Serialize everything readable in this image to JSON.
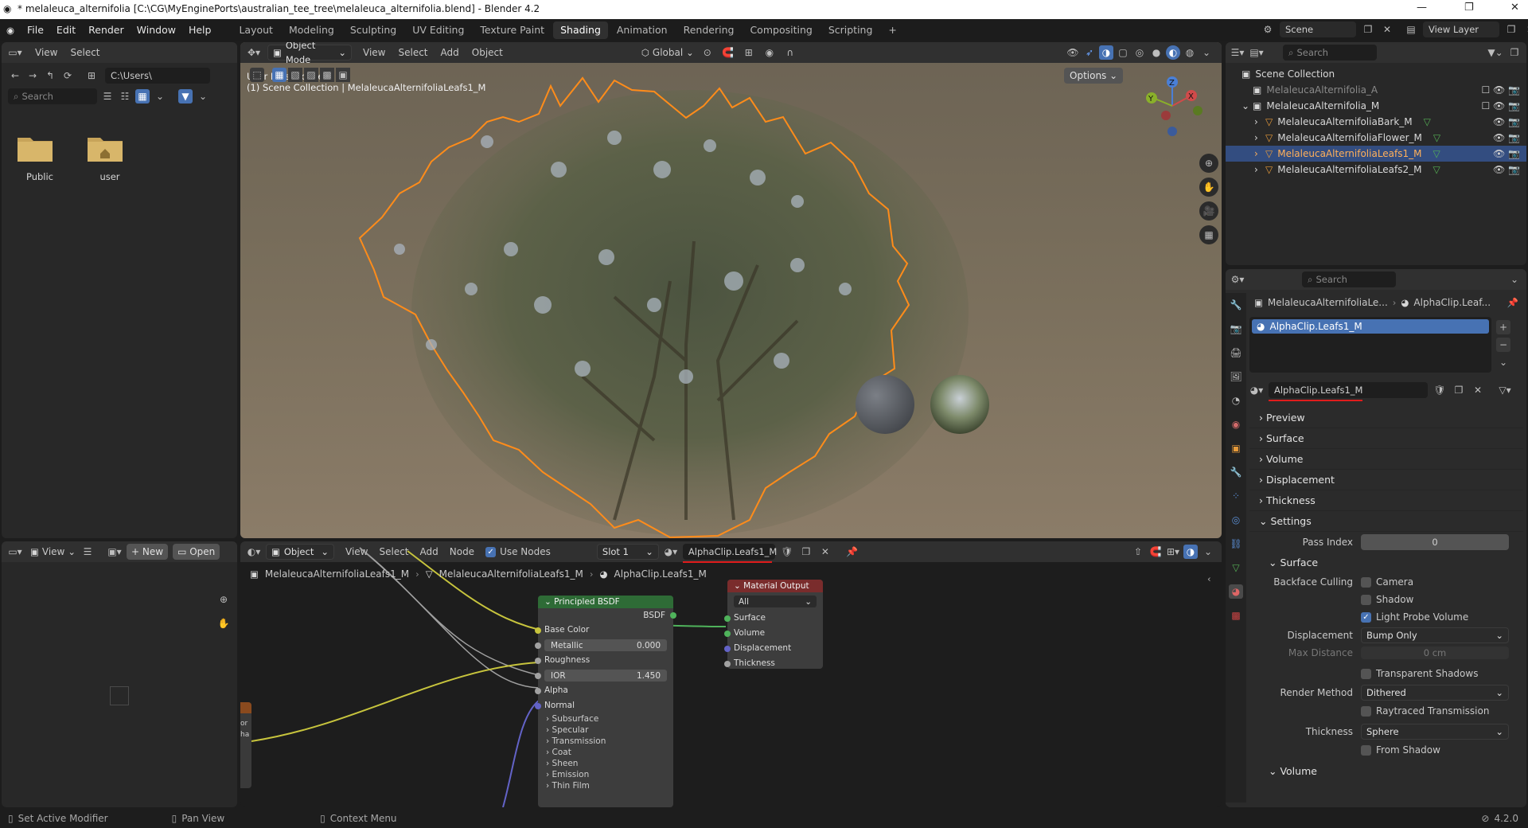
{
  "window": {
    "title": "* melaleuca_alternifolia [C:\\CG\\MyEnginePorts\\australian_tee_tree\\melaleuca_alternifolia.blend] - Blender 4.2"
  },
  "menubar": {
    "menus": [
      "File",
      "Edit",
      "Render",
      "Window",
      "Help"
    ],
    "workspaces": [
      "Layout",
      "Modeling",
      "Sculpting",
      "UV Editing",
      "Texture Paint",
      "Shading",
      "Animation",
      "Rendering",
      "Compositing",
      "Scripting"
    ],
    "active_workspace": "Shading",
    "scene": "Scene",
    "view_layer": "View Layer"
  },
  "file_browser": {
    "menus": [
      "View",
      "Select"
    ],
    "path": "C:\\Users\\",
    "search_placeholder": "Search",
    "folders": [
      "Public",
      "user"
    ]
  },
  "viewport": {
    "mode": "Object Mode",
    "menus": [
      "View",
      "Select",
      "Add",
      "Object"
    ],
    "transform": "Global",
    "options": "Options",
    "overlay_line1": "User Perspective",
    "overlay_line2": "(1) Scene Collection | MelaleucaAlternifoliaLeafs1_M",
    "gizmo": {
      "z": "Z",
      "y": "Y",
      "x": "X"
    }
  },
  "outliner": {
    "search_placeholder": "Search",
    "root": "Scene Collection",
    "items": [
      {
        "label": "MelaleucaAlternifolia_A",
        "depth": 1,
        "state": "disabled"
      },
      {
        "label": "MelaleucaAlternifolia_M",
        "depth": 1,
        "state": "normal"
      },
      {
        "label": "MelaleucaAlternifoliaBark_M",
        "depth": 2,
        "state": "normal"
      },
      {
        "label": "MelaleucaAlternifoliaFlower_M",
        "depth": 2,
        "state": "normal"
      },
      {
        "label": "MelaleucaAlternifoliaLeafs1_M",
        "depth": 2,
        "state": "selected"
      },
      {
        "label": "MelaleucaAlternifoliaLeafs2_M",
        "depth": 2,
        "state": "normal"
      }
    ]
  },
  "properties": {
    "search_placeholder": "Search",
    "breadcrumb_object": "MelaleucaAlternifoliaLe...",
    "breadcrumb_material": "AlphaClip.Leaf...",
    "slot_item": "AlphaClip.Leafs1_M",
    "material_name": "AlphaClip.Leafs1_M",
    "sections": [
      "Preview",
      "Surface",
      "Volume",
      "Displacement",
      "Thickness",
      "Settings"
    ],
    "pass_index_label": "Pass Index",
    "pass_index": "0",
    "surface_sub": "Surface",
    "backface_culling_label": "Backface Culling",
    "camera": "Camera",
    "shadow": "Shadow",
    "light_probe_volume": "Light Probe Volume",
    "displacement_label": "Displacement",
    "displacement_value": "Bump Only",
    "max_distance_label": "Max Distance",
    "max_distance_value": "0 cm",
    "transparent_shadows": "Transparent Shadows",
    "render_method_label": "Render Method",
    "render_method_value": "Dithered",
    "raytraced_transmission": "Raytraced Transmission",
    "thickness_label": "Thickness",
    "thickness_value": "Sphere",
    "from_shadow": "From Shadow",
    "volume_sub": "Volume"
  },
  "image_editor": {
    "view": "View",
    "new": "New",
    "open": "Open"
  },
  "node_editor": {
    "type": "Object",
    "menus": [
      "View",
      "Select",
      "Add",
      "Node"
    ],
    "use_nodes": "Use Nodes",
    "slot": "Slot 1",
    "material": "AlphaClip.Leafs1_M",
    "breadcrumb": [
      "MelaleucaAlternifoliaLeafs1_M",
      "MelaleucaAlternifoliaLeafs1_M",
      "AlphaClip.Leafs1_M"
    ],
    "bsdf": {
      "title": "Principled BSDF",
      "output": "BSDF",
      "base_color": "Base Color",
      "metallic_label": "Metallic",
      "metallic": "0.000",
      "roughness": "Roughness",
      "ior_label": "IOR",
      "ior": "1.450",
      "alpha": "Alpha",
      "normal": "Normal",
      "panels": [
        "Subsurface",
        "Specular",
        "Transmission",
        "Coat",
        "Sheen",
        "Emission",
        "Thin Film"
      ]
    },
    "output_node": {
      "title": "Material Output",
      "target": "All",
      "sockets": [
        "Surface",
        "Volume",
        "Displacement",
        "Thickness"
      ]
    },
    "left_node_frag": [
      "or",
      "ha"
    ]
  },
  "statusbar": {
    "left": "Set Active Modifier",
    "mid": "Pan View",
    "right": "Context Menu",
    "version": "4.2.0"
  },
  "colors": {
    "accent": "#4772b3",
    "selection_orange": "#ff8c1a",
    "bsdf_header": "#2e6b36",
    "output_header": "#7a2c2c",
    "yellow_link": "#c7c43d",
    "underline": "#e01c1c"
  }
}
